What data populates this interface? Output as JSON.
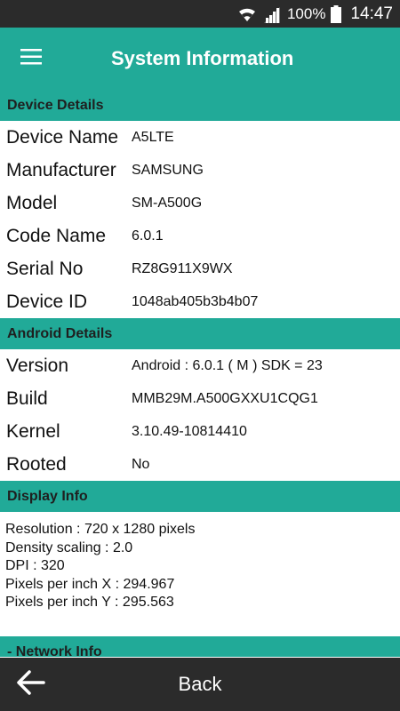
{
  "status_bar": {
    "battery_percent": "100%",
    "time": "14:47",
    "icons": [
      "wifi-icon",
      "signal-icon",
      "battery-icon"
    ]
  },
  "app_bar": {
    "title": "System Information",
    "menu_icon": "hamburger-menu-icon"
  },
  "device_details": {
    "header": "Device Details",
    "rows": [
      {
        "label": "Device Name",
        "value": "A5LTE"
      },
      {
        "label": "Manufacturer",
        "value": "SAMSUNG"
      },
      {
        "label": "Model",
        "value": "SM-A500G"
      },
      {
        "label": "Code Name",
        "value": "6.0.1"
      },
      {
        "label": "Serial No",
        "value": "RZ8G911X9WX"
      },
      {
        "label": "Device ID",
        "value": "1048ab405b3b4b07"
      }
    ]
  },
  "android_details": {
    "header": "Android Details",
    "rows": [
      {
        "label": "Version",
        "value": "Android : 6.0.1 ( M ) SDK = 23"
      },
      {
        "label": "Build",
        "value": "MMB29M.A500GXXU1CQG1"
      },
      {
        "label": "Kernel",
        "value": "3.10.49-10814410"
      },
      {
        "label": "Rooted",
        "value": "No"
      }
    ]
  },
  "display_info": {
    "header": "Display Info",
    "lines": [
      "Resolution : 720 x 1280 pixels",
      "Density scaling : 2.0",
      "DPI : 320",
      "Pixels per inch X : 294.967",
      "Pixels per inch Y : 295.563"
    ]
  },
  "network_info": {
    "header": "- Network Info"
  },
  "bottom_bar": {
    "back_label": "Back",
    "back_icon": "arrow-left-icon"
  },
  "colors": {
    "accent": "#21aa98",
    "status_bar": "#2b2b2b",
    "bottom_bar": "#2b2b2b"
  }
}
